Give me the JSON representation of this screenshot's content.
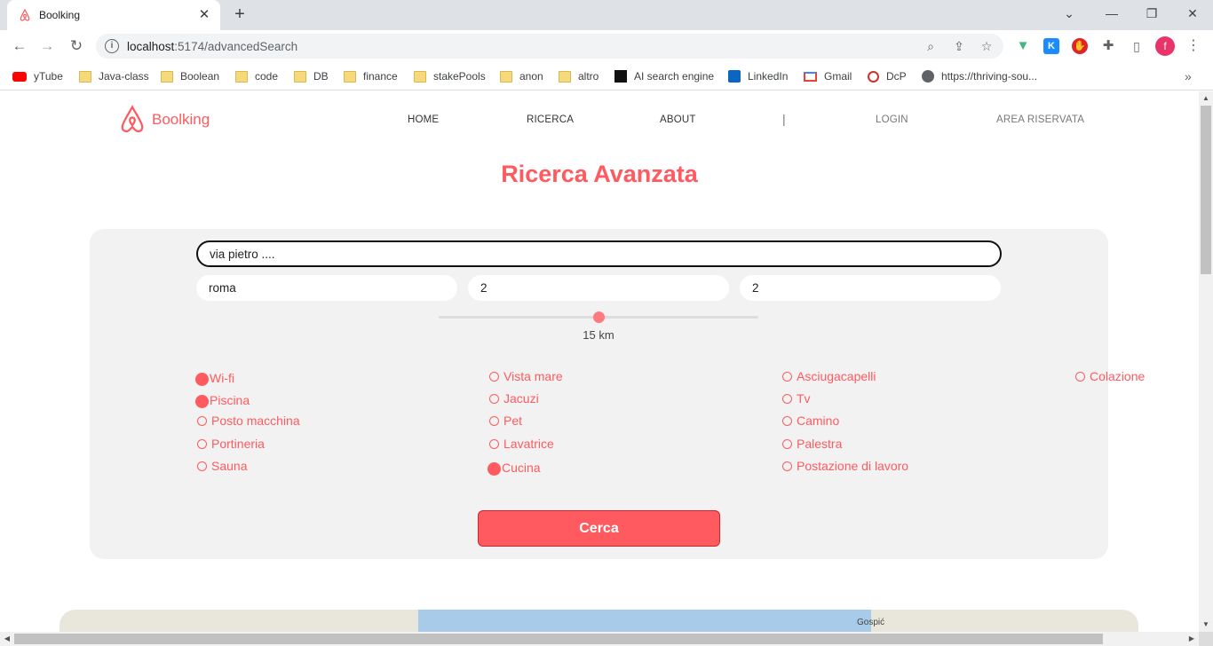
{
  "browser": {
    "tab_title": "Boolking",
    "url_host": "localhost",
    "url_rest": ":5174/advancedSearch",
    "avatar_letter": "f",
    "bookmarks": [
      {
        "label": "yTube",
        "icon": "youtube-icon"
      },
      {
        "label": "Java-class",
        "icon": "folder-icon"
      },
      {
        "label": "Boolean",
        "icon": "folder-icon"
      },
      {
        "label": "code",
        "icon": "folder-icon"
      },
      {
        "label": "DB",
        "icon": "folder-icon"
      },
      {
        "label": "finance",
        "icon": "folder-icon"
      },
      {
        "label": "stakePools",
        "icon": "folder-icon"
      },
      {
        "label": "anon",
        "icon": "folder-icon"
      },
      {
        "label": "altro",
        "icon": "folder-icon"
      },
      {
        "label": "AI search engine",
        "icon": "perplexity-icon"
      },
      {
        "label": "LinkedIn",
        "icon": "linkedin-icon"
      },
      {
        "label": "Gmail",
        "icon": "gmail-icon"
      },
      {
        "label": "DcP",
        "icon": "dcp-icon"
      },
      {
        "label": "https://thriving-sou...",
        "icon": "globe-icon"
      }
    ]
  },
  "header": {
    "brand": "Boolking",
    "nav": {
      "home": "HOME",
      "ricerca": "RICERCA",
      "about": "ABOUT",
      "separator": "|",
      "login": "LOGIN",
      "area": "AREA RISERVATA"
    }
  },
  "page": {
    "title": "Ricerca Avanzata"
  },
  "search": {
    "address_value": "via pietro ....",
    "city_value": "roma",
    "rooms_value": "2",
    "beds_value": "2",
    "radius": {
      "value": 15,
      "min": 0,
      "max": 30,
      "label": "15 km"
    },
    "submit_label": "Cerca",
    "amenities": [
      {
        "label": "Wi-fi",
        "checked": true
      },
      {
        "label": "Piscina",
        "checked": true
      },
      {
        "label": "Posto macchina",
        "checked": false
      },
      {
        "label": "Portineria",
        "checked": false
      },
      {
        "label": "Sauna",
        "checked": false
      },
      {
        "label": "Vista mare",
        "checked": false
      },
      {
        "label": "Jacuzi",
        "checked": false
      },
      {
        "label": "Pet",
        "checked": false
      },
      {
        "label": "Lavatrice",
        "checked": false
      },
      {
        "label": "Cucina",
        "checked": true
      },
      {
        "label": "Asciugacapelli",
        "checked": false
      },
      {
        "label": "Tv",
        "checked": false
      },
      {
        "label": "Camino",
        "checked": false
      },
      {
        "label": "Palestra",
        "checked": false
      },
      {
        "label": "Postazione di lavoro",
        "checked": false
      },
      {
        "label": "Colazione",
        "checked": false
      }
    ]
  },
  "map": {
    "place_label": "Gospić"
  },
  "colors": {
    "accent": "#ff5a5f",
    "card": "#f2f2f2"
  }
}
